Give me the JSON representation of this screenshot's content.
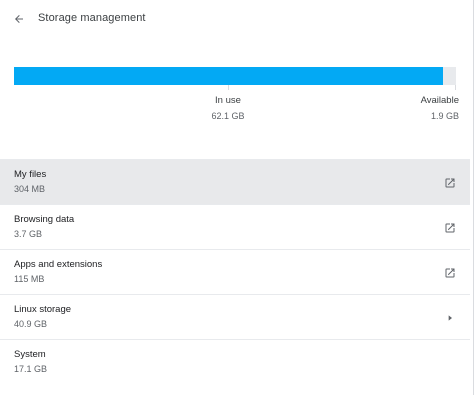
{
  "header": {
    "title": "Storage management",
    "back_icon": "arrow-back-icon"
  },
  "usage": {
    "used_fraction": 0.97,
    "accent_color": "#03a9f4",
    "in_use_label": "In use",
    "in_use_value": "62.1 GB",
    "available_label": "Available",
    "available_value": "1.9 GB"
  },
  "items": [
    {
      "name": "My files",
      "size": "304 MB",
      "action_icon": "open-in-new-icon",
      "selected": true
    },
    {
      "name": "Browsing data",
      "size": "3.7 GB",
      "action_icon": "open-in-new-icon"
    },
    {
      "name": "Apps and extensions",
      "size": "115 MB",
      "action_icon": "open-in-new-icon"
    },
    {
      "name": "Linux storage",
      "size": "40.9 GB",
      "action_icon": "chevron-right-icon"
    },
    {
      "name": "System",
      "size": "17.1 GB"
    }
  ]
}
